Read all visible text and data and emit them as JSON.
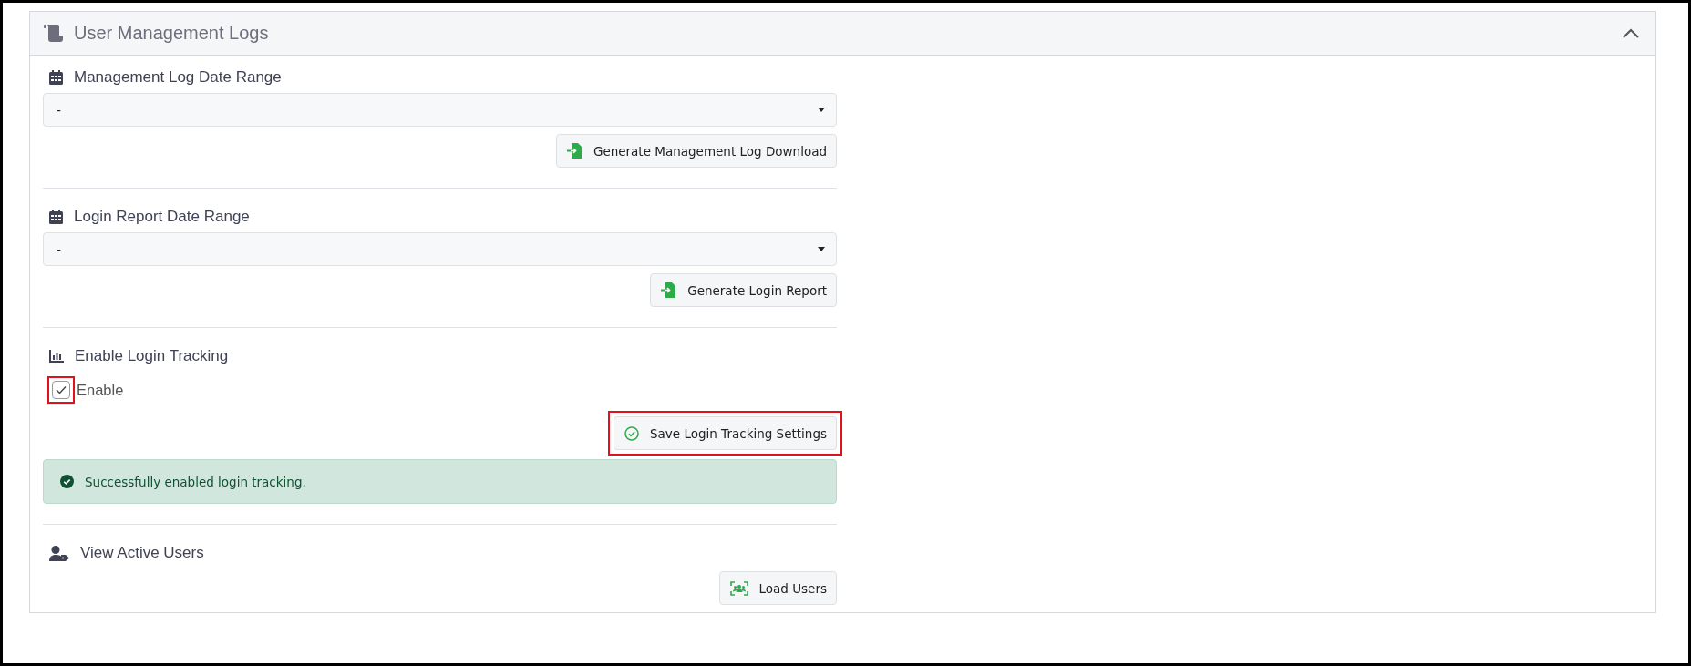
{
  "panel": {
    "title": "User Management Logs",
    "expanded": true
  },
  "sections": [
    {
      "kind": "date_range",
      "title": "Management Log Date Range",
      "select_value": "-",
      "button": {
        "label": "Generate Management Log Download",
        "highlighted": false
      }
    },
    {
      "kind": "date_range",
      "title": "Login Report Date Range",
      "select_value": "-",
      "button": {
        "label": "Generate Login Report",
        "highlighted": false
      }
    },
    {
      "kind": "toggle",
      "title": "Enable Login Tracking",
      "checkbox": {
        "label": "Enable",
        "checked": true,
        "highlighted": true
      },
      "button": {
        "label": "Save Login Tracking Settings",
        "highlighted": true
      },
      "alert": {
        "text": "Successfully enabled login tracking."
      }
    },
    {
      "kind": "action",
      "title": "View Active Users",
      "button": {
        "label": "Load Users",
        "highlighted": false
      }
    }
  ]
}
